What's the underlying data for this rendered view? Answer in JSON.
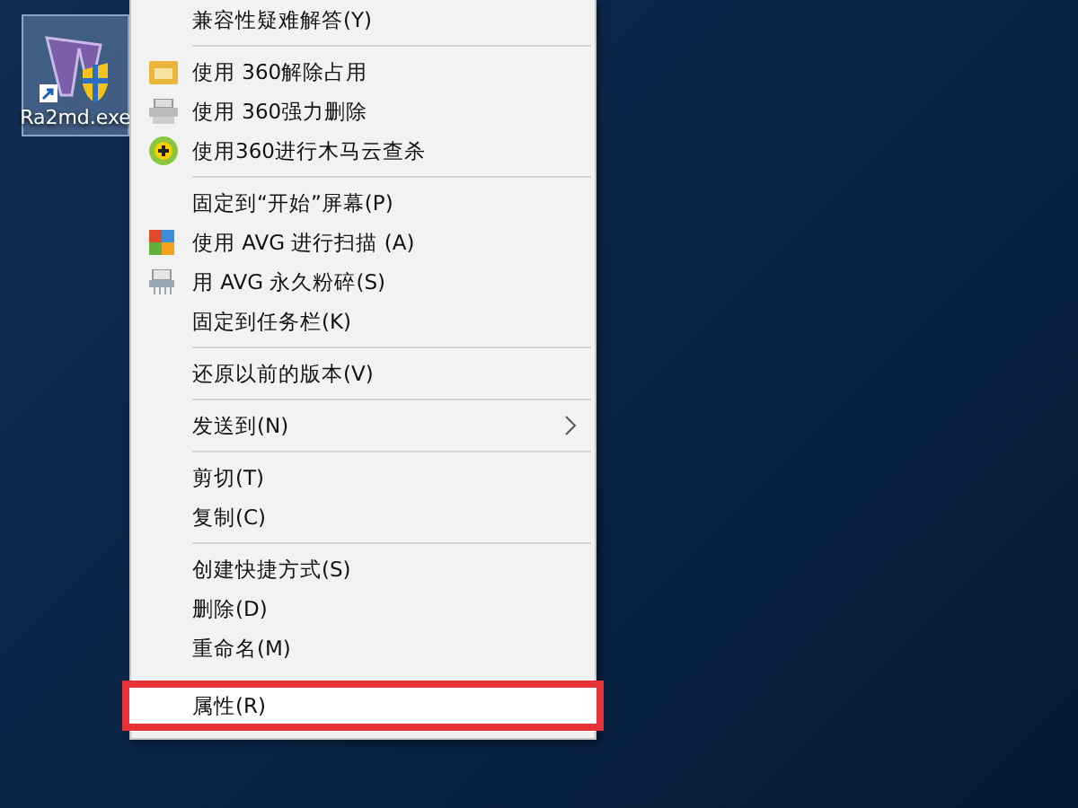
{
  "desktop_icon": {
    "label": "Ra2md.exe",
    "selected": true
  },
  "context_menu": {
    "items": [
      {
        "kind": "plain",
        "label": "兼容性疑难解答(Y)",
        "outlined": false
      },
      {
        "kind": "separator"
      },
      {
        "kind": "with-icon",
        "label": "使用 360解除占用",
        "outlined": false
      },
      {
        "kind": "with-icon",
        "label": "使用 360强力删除",
        "outlined": false
      },
      {
        "kind": "with-icon",
        "label": "使用360进行木马云查杀",
        "outlined": false
      },
      {
        "kind": "separator"
      },
      {
        "kind": "plain",
        "label": "固定到“开始”屏幕(P)",
        "outlined": false
      },
      {
        "kind": "with-icon",
        "label": "使用 AVG 进行扫描 (A)",
        "outlined": false
      },
      {
        "kind": "with-icon",
        "label": "用 AVG 永久粉碎(S)",
        "outlined": false
      },
      {
        "kind": "plain",
        "label": "固定到任务栏(K)",
        "outlined": false
      },
      {
        "kind": "separator"
      },
      {
        "kind": "plain",
        "label": "还原以前的版本(V)",
        "outlined": false
      },
      {
        "kind": "separator"
      },
      {
        "kind": "submenu",
        "label": "发送到(N)",
        "outlined": false
      },
      {
        "kind": "separator"
      },
      {
        "kind": "plain",
        "label": "剪切(T)",
        "outlined": false
      },
      {
        "kind": "plain",
        "label": "复制(C)",
        "outlined": false
      },
      {
        "kind": "separator"
      },
      {
        "kind": "plain",
        "label": "创建快捷方式(S)",
        "outlined": false
      },
      {
        "kind": "plain",
        "label": "删除(D)",
        "outlined": false
      },
      {
        "kind": "plain",
        "label": "重命名(M)",
        "outlined": false
      },
      {
        "kind": "plain",
        "label": "属性(R)",
        "outlined": true
      }
    ]
  }
}
